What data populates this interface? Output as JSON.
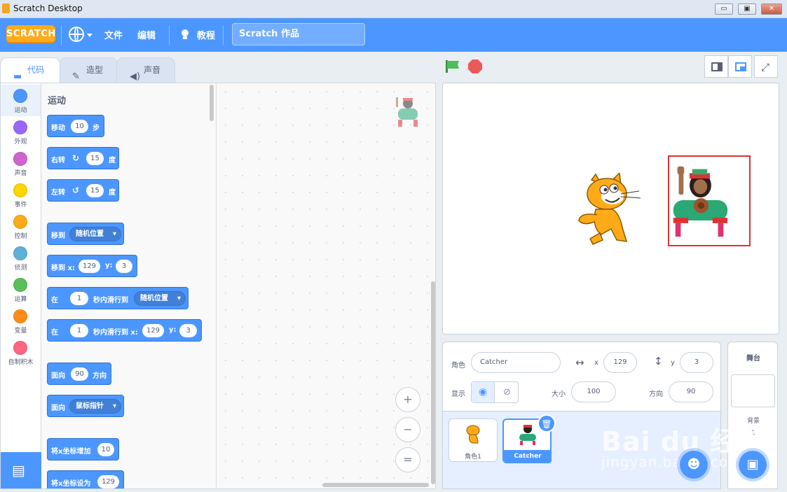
{
  "window": {
    "title": "Scratch Desktop",
    "minimize": "▭",
    "maximize": "▣",
    "close": "✕"
  },
  "menubar": {
    "logo": "SCRATCH",
    "file": "文件",
    "edit": "编辑",
    "tutorials": "教程",
    "project_title": "Scratch 作品"
  },
  "tabs": [
    {
      "label": "代码",
      "icon": "code-icon"
    },
    {
      "label": "造型",
      "icon": "brush-icon"
    },
    {
      "label": "声音",
      "icon": "speaker-icon"
    }
  ],
  "categories": [
    {
      "label": "运动",
      "color": "#4c97ff"
    },
    {
      "label": "外观",
      "color": "#9966ff"
    },
    {
      "label": "声音",
      "color": "#cf63cf"
    },
    {
      "label": "事件",
      "color": "#ffd500"
    },
    {
      "label": "控制",
      "color": "#ffab19"
    },
    {
      "label": "侦测",
      "color": "#5cb1d6"
    },
    {
      "label": "运算",
      "color": "#59c059"
    },
    {
      "label": "变量",
      "color": "#ff8c1a"
    },
    {
      "label": "自制积木",
      "color": "#ff6680"
    }
  ],
  "palette": {
    "heading": "运动",
    "move": {
      "a": "移动",
      "v": "10",
      "b": "步"
    },
    "turn_right": {
      "a": "右转",
      "v": "15",
      "b": "度"
    },
    "turn_left": {
      "a": "左转",
      "v": "15",
      "b": "度"
    },
    "goto": {
      "a": "移到",
      "dd": "随机位置"
    },
    "goto_xy": {
      "a": "移到 x:",
      "x": "129",
      "b": "y:",
      "y": "3"
    },
    "glide": {
      "a": "在",
      "v": "1",
      "b": "秒内滑行到",
      "dd": "随机位置"
    },
    "glide_xy": {
      "a": "在",
      "v": "1",
      "b": "秒内滑行到 x:",
      "x": "129",
      "c": "y:",
      "y": "3"
    },
    "point": {
      "a": "面向",
      "v": "90",
      "b": "方向"
    },
    "point_towards": {
      "a": "面向",
      "dd": "鼠标指针"
    },
    "change_x": {
      "a": "将x坐标增加",
      "v": "10"
    },
    "set_x": {
      "a": "将x坐标设为",
      "v": "129"
    }
  },
  "zoom": {
    "in": "+",
    "out": "−",
    "reset": "="
  },
  "sprite_info": {
    "sprite_label": "角色",
    "sprite_name": "Catcher",
    "x_label": "x",
    "x": "129",
    "y_label": "y",
    "y": "3",
    "show_label": "显示",
    "size_label": "大小",
    "size": "100",
    "direction_label": "方向",
    "direction": "90"
  },
  "sprites": [
    {
      "name": "角色1"
    },
    {
      "name": "Catcher"
    }
  ],
  "stage_pane": {
    "heading": "舞台",
    "backdrops_label": "背景",
    "backdrops_count": "1"
  },
  "watermark": {
    "line1": "Bai  du 经验",
    "line2": "jingyan.baidu.com"
  }
}
